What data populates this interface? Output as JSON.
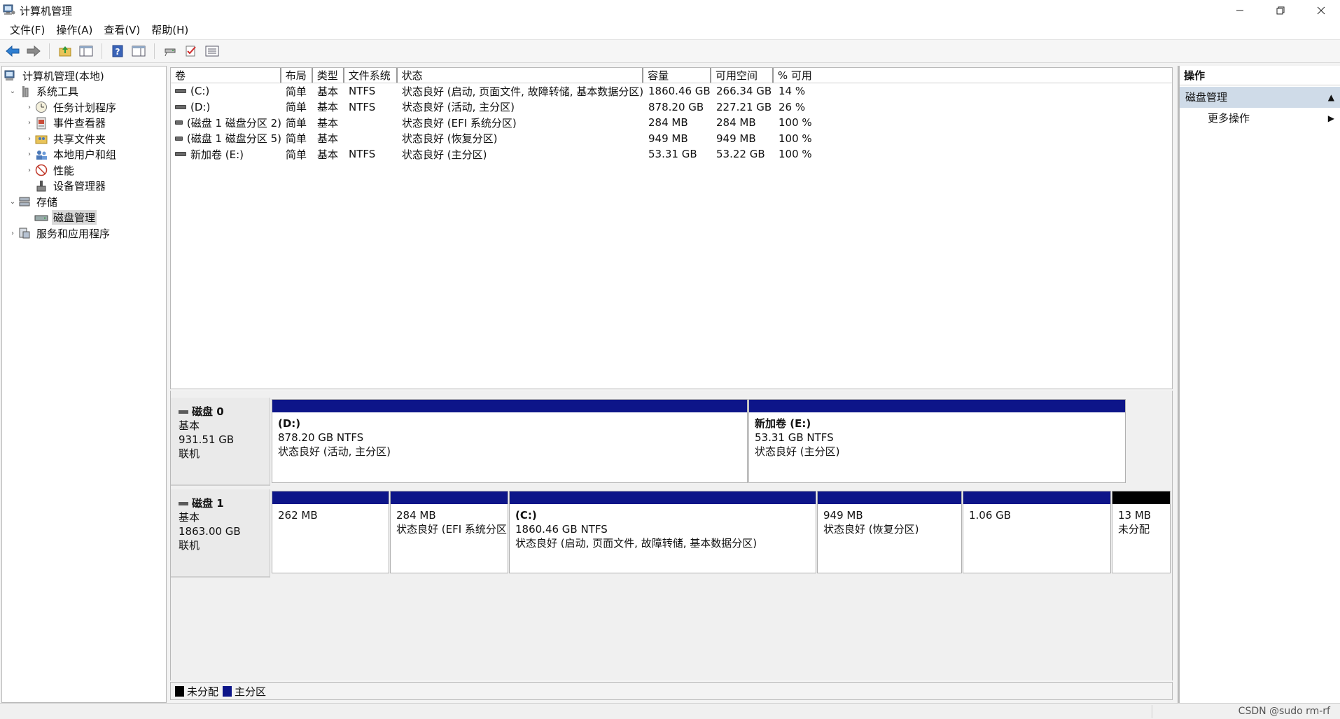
{
  "window": {
    "title": "计算机管理",
    "icon": "computer-management-icon"
  },
  "menu": [
    "文件(F)",
    "操作(A)",
    "查看(V)",
    "帮助(H)"
  ],
  "toolbar_icons": [
    "back-arrow-icon",
    "forward-arrow-icon",
    "up-folder-icon",
    "show-hide-tree-icon",
    "help-icon",
    "properties-icon",
    "connect-icon",
    "check-icon",
    "list-view-icon"
  ],
  "tree": [
    {
      "label": "计算机管理(本地)",
      "level": 0,
      "arrow": "",
      "icon": "computer-management-icon"
    },
    {
      "label": "系统工具",
      "level": 1,
      "arrow": "⌄",
      "icon": "system-tools-icon"
    },
    {
      "label": "任务计划程序",
      "level": 2,
      "arrow": "›",
      "icon": "clock-icon"
    },
    {
      "label": "事件查看器",
      "level": 2,
      "arrow": "›",
      "icon": "event-viewer-icon"
    },
    {
      "label": "共享文件夹",
      "level": 2,
      "arrow": "›",
      "icon": "shared-folder-icon"
    },
    {
      "label": "本地用户和组",
      "level": 2,
      "arrow": "›",
      "icon": "users-icon"
    },
    {
      "label": "性能",
      "level": 2,
      "arrow": "›",
      "icon": "performance-icon"
    },
    {
      "label": "设备管理器",
      "level": 2,
      "arrow": "",
      "icon": "device-manager-icon"
    },
    {
      "label": "存储",
      "level": 1,
      "arrow": "⌄",
      "icon": "storage-icon"
    },
    {
      "label": "磁盘管理",
      "level": 2,
      "arrow": "",
      "icon": "disk-icon",
      "selected": true
    },
    {
      "label": "服务和应用程序",
      "level": 1,
      "arrow": "›",
      "icon": "services-icon"
    }
  ],
  "volumes": {
    "headers": [
      "卷",
      "布局",
      "类型",
      "文件系统",
      "状态",
      "容量",
      "可用空间",
      "% 可用"
    ],
    "rows": [
      [
        "(C:)",
        "简单",
        "基本",
        "NTFS",
        "状态良好 (启动, 页面文件, 故障转储, 基本数据分区)",
        "1860.46 GB",
        "266.34 GB",
        "14 %"
      ],
      [
        "(D:)",
        "简单",
        "基本",
        "NTFS",
        "状态良好 (活动, 主分区)",
        "878.20 GB",
        "227.21 GB",
        "26 %"
      ],
      [
        "(磁盘 1 磁盘分区 2)",
        "简单",
        "基本",
        "",
        "状态良好 (EFI 系统分区)",
        "284 MB",
        "284 MB",
        "100 %"
      ],
      [
        "(磁盘 1 磁盘分区 5)",
        "简单",
        "基本",
        "",
        "状态良好 (恢复分区)",
        "949 MB",
        "949 MB",
        "100 %"
      ],
      [
        "新加卷 (E:)",
        "简单",
        "基本",
        "NTFS",
        "状态良好 (主分区)",
        "53.31 GB",
        "53.22 GB",
        "100 %"
      ]
    ]
  },
  "disks": [
    {
      "name": "磁盘 0",
      "type": "基本",
      "size": "931.51 GB",
      "status": "联机",
      "partitions": [
        {
          "name": "(D:)",
          "size": "878.20 GB NTFS",
          "status": "状态良好 (活动, 主分区)",
          "kind": "primary"
        },
        {
          "name": "新加卷  (E:)",
          "size": "53.31 GB NTFS",
          "status": "状态良好 (主分区)",
          "kind": "primary"
        }
      ]
    },
    {
      "name": "磁盘 1",
      "type": "基本",
      "size": "1863.00 GB",
      "status": "联机",
      "partitions": [
        {
          "name": "",
          "size": "262 MB",
          "status": "",
          "kind": "primary"
        },
        {
          "name": "",
          "size": "284 MB",
          "status": "状态良好 (EFI 系统分区",
          "kind": "primary"
        },
        {
          "name": "(C:)",
          "size": "1860.46 GB NTFS",
          "status": "状态良好 (启动, 页面文件, 故障转储, 基本数据分区)",
          "kind": "primary"
        },
        {
          "name": "",
          "size": "949 MB",
          "status": "状态良好 (恢复分区)",
          "kind": "primary"
        },
        {
          "name": "",
          "size": "1.06 GB",
          "status": "",
          "kind": "primary"
        },
        {
          "name": "",
          "size": "13 MB",
          "status": "未分配",
          "kind": "unallocated"
        }
      ]
    }
  ],
  "legend": [
    {
      "label": "未分配",
      "color": "#000000"
    },
    {
      "label": "主分区",
      "color": "#0d1589"
    }
  ],
  "actions": {
    "title": "操作",
    "section": "磁盘管理",
    "items": [
      "更多操作"
    ]
  },
  "status": {
    "watermark": "CSDN @sudo rm-rf"
  },
  "colors": {
    "primary_partition": "#0d1589",
    "unallocated": "#000000",
    "action_section_bg": "#cfdbe8"
  }
}
